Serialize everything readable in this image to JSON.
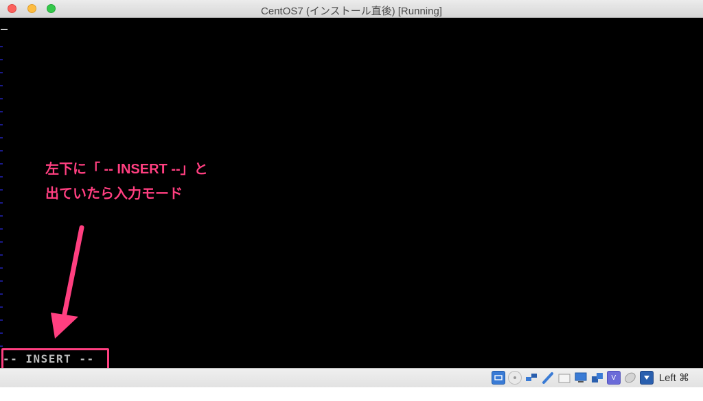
{
  "window": {
    "title": "CentOS7 (インストール直後) [Running]"
  },
  "annotation": {
    "line1": "左下に「 -- INSERT --」と",
    "line2": "出ていたら入力モード",
    "color": "#ff3f80"
  },
  "terminal": {
    "mode_line": "-- INSERT --"
  },
  "statusbar": {
    "icons": [
      "hard-disk-icon",
      "optical-drive-icon",
      "network-icon",
      "usb-icon",
      "shared-folders-icon",
      "display-icon",
      "video-capture-icon",
      "virtualbox-icon",
      "mouse-integration-icon",
      "keyboard-capture-icon"
    ],
    "host_key": "Left ⌘"
  }
}
